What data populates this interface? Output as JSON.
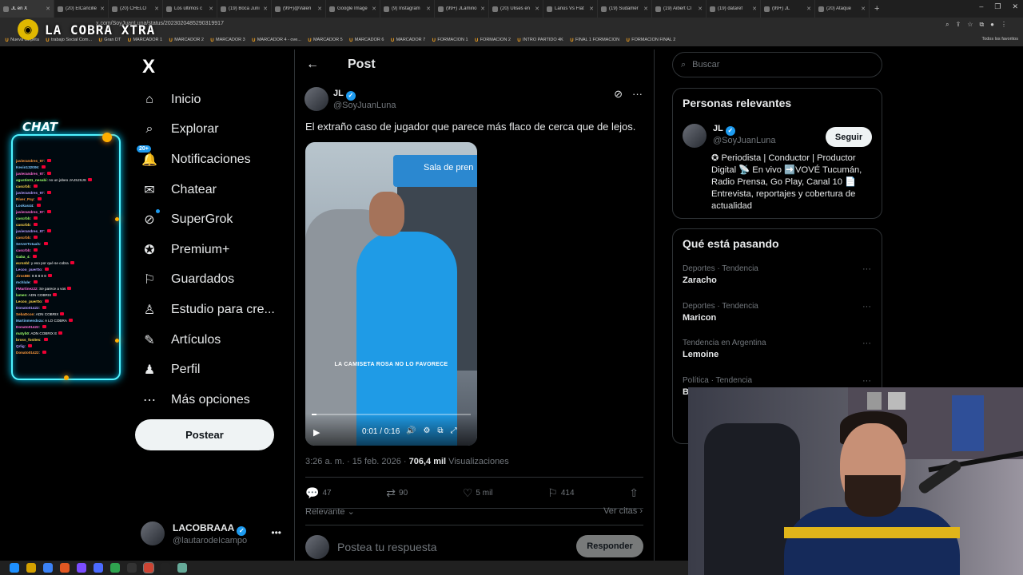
{
  "browser": {
    "tabs": [
      {
        "label": "JL en X",
        "active": true
      },
      {
        "label": "(20) ElCancille"
      },
      {
        "label": "(20) CHELO"
      },
      {
        "label": "Los últimos c"
      },
      {
        "label": "(19) Boca Juni"
      },
      {
        "label": "(99+)@Valeri"
      },
      {
        "label": "Google Image"
      },
      {
        "label": "(9) Instagram"
      },
      {
        "label": "(99+) JLamino"
      },
      {
        "label": "(20) Ulises en"
      },
      {
        "label": "Lanús Vs Flat"
      },
      {
        "label": "(19) Sudamér"
      },
      {
        "label": "(19) Aibert Cl"
      },
      {
        "label": "(19) dataref"
      },
      {
        "label": "(99+) JL"
      },
      {
        "label": "(20) Ataque"
      }
    ],
    "url": "x.com/SoyJuanLuna/status/2023020485290319917",
    "bookmarks": [
      "Nueva carpeta",
      "trabajo Social Com...",
      "Gran DT",
      "MARCADOR 1",
      "MARCADOR 2",
      "MARCADOR 3",
      "MARCADOR 4 - ove...",
      "MARCADOR 5",
      "MARCADOR 6",
      "MARCADOR 7",
      "FORMACION 1",
      "FORMACION 2",
      "INTRO PARTIDO 4K",
      "FINAL 1 FORMACION",
      "FORMACION FINAL 2"
    ],
    "all_bookmarks": "Todos los favoritos"
  },
  "overlay": {
    "logo_text": "LA COBRA XTRA",
    "chat_title": "CHAT",
    "chat_messages": [
      {
        "user": "javierandres_97",
        "text": ""
      },
      {
        "user": "Kevin132006",
        "text": ""
      },
      {
        "user": "javierandres_97",
        "text": ""
      },
      {
        "user": "agustin01_nesabi",
        "text": "no un jobeo JAJSJSJS"
      },
      {
        "user": "cascrbb",
        "text": ""
      },
      {
        "user": "javierandres_97",
        "text": ""
      },
      {
        "user": "River_Pay",
        "text": ""
      },
      {
        "user": "Lookas44",
        "text": ""
      },
      {
        "user": "javierandres_97",
        "text": ""
      },
      {
        "user": "cascrbb",
        "text": ""
      },
      {
        "user": "cascrbb",
        "text": ""
      },
      {
        "user": "javierandres_97",
        "text": ""
      },
      {
        "user": "cascrbb",
        "text": ""
      },
      {
        "user": "ServerTotaal1",
        "text": ""
      },
      {
        "user": "cascrbb",
        "text": ""
      },
      {
        "user": "Gaba_4",
        "text": ""
      },
      {
        "user": "ecrsnbl",
        "text": "y eso por qué se cobra"
      },
      {
        "user": "Lecoo_puertto",
        "text": ""
      },
      {
        "user": "JirssBB",
        "text": "8 8 8 8 8"
      },
      {
        "user": "mchlule",
        "text": ""
      },
      {
        "user": "FMartinez22",
        "text": "Se parece a vos"
      },
      {
        "user": "lamen",
        "text": "ADN COBRIX"
      },
      {
        "user": "Lecoo_puertto",
        "text": ""
      },
      {
        "user": "Donato01422",
        "text": ""
      },
      {
        "user": "SebaDcon",
        "text": "ADN COBRIX"
      },
      {
        "user": "Martinmendoza",
        "text": "A LO COBRA"
      },
      {
        "user": "Donato01422",
        "text": ""
      },
      {
        "user": "matyb0",
        "text": "ADN COBRIX E"
      },
      {
        "user": "bross_fosttes",
        "text": ""
      },
      {
        "user": "Qrlig",
        "text": ""
      },
      {
        "user": "Donato01422",
        "text": ""
      }
    ]
  },
  "nav": {
    "logo": "X",
    "items": [
      {
        "label": "Inicio",
        "icon": "home-icon"
      },
      {
        "label": "Explorar",
        "icon": "search-icon"
      },
      {
        "label": "Notificaciones",
        "icon": "bell-icon",
        "badge": "20+"
      },
      {
        "label": "Chatear",
        "icon": "mail-icon"
      },
      {
        "label": "SuperGrok",
        "icon": "grok-icon"
      },
      {
        "label": "Premium+",
        "icon": "verified-icon"
      },
      {
        "label": "Guardados",
        "icon": "bookmark-icon"
      },
      {
        "label": "Estudio para cre...",
        "icon": "studio-icon"
      },
      {
        "label": "Artículos",
        "icon": "article-icon"
      },
      {
        "label": "Perfil",
        "icon": "person-icon"
      },
      {
        "label": "Más opciones",
        "icon": "more-icon"
      }
    ],
    "post_button": "Postear",
    "account": {
      "name": "LACOBRAAA",
      "handle": "@lautarodeIcampo"
    }
  },
  "post": {
    "header": "Post",
    "author": {
      "name": "JL",
      "handle": "@SoyJuanLuna"
    },
    "text": "El extraño caso de jugador que parece más flaco de cerca que de lejos.",
    "video": {
      "caption": "LA CAMISETA ROSA NO LO FAVORECE",
      "time": "0:01 / 0:16",
      "sign": "Sala de pren",
      "progress": 0.03
    },
    "meta_time": "3:26 a. m. · 15 feb. 2026 · ",
    "meta_views": "706,4 mil",
    "meta_views_label": " Visualizaciones",
    "stats": {
      "replies": "47",
      "reposts": "90",
      "likes": "5 mil",
      "bookmarks": "414"
    },
    "sort": "Relevante",
    "quotes": "Ver citas",
    "reply_placeholder": "Postea tu respuesta",
    "reply_button": "Responder"
  },
  "sidebar": {
    "search_placeholder": "Buscar",
    "relevant_title": "Personas relevantes",
    "person": {
      "name": "JL",
      "handle": "@SoyJuanLuna",
      "follow": "Seguir",
      "bio": "✪ Periodista | Conductor | Productor Digital 📡 En vivo ➡️VOVÉ Tucumán, Radio Prensa, Go Play, Canal 10 📄 Entrevista, reportajes y cobertura de actualidad"
    },
    "trends_title": "Qué está pasando",
    "trends": [
      {
        "category": "Deportes · Tendencia",
        "name": "Zaracho"
      },
      {
        "category": "Deportes · Tendencia",
        "name": "Maricon"
      },
      {
        "category": "Tendencia en Argentina",
        "name": "Lemoine"
      },
      {
        "category": "Política · Tendencia",
        "name": "B"
      }
    ]
  }
}
